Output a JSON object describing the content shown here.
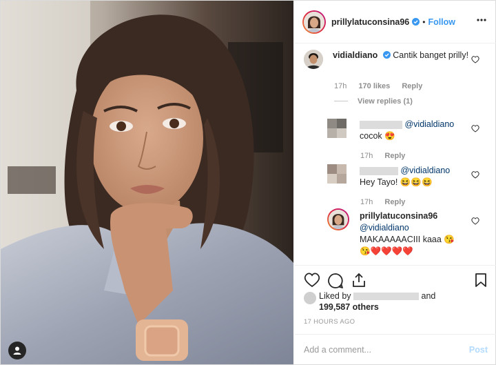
{
  "header": {
    "username": "prillylatuconsina96",
    "separator": "•",
    "follow_label": "Follow",
    "verified_icon": "verified-badge-icon",
    "more_icon": "more-options-icon"
  },
  "comments": {
    "main": {
      "username": "vidialdiano",
      "text": "Cantik banget prilly!",
      "time": "17h",
      "likes": "170 likes",
      "reply_label": "Reply",
      "view_replies": "View replies (1)"
    },
    "replies": [
      {
        "mention": "@vidialdiano",
        "text": "cocok 😍",
        "time": "17h",
        "reply_label": "Reply"
      },
      {
        "mention": "@vidialdiano",
        "text": "Hey Tayo! 😆😆😆",
        "time": "17h",
        "reply_label": "Reply"
      },
      {
        "username": "prillylatuconsina96",
        "mention": "@vidialdiano",
        "text": "MAKAAAAACIII kaaa 😘",
        "hearts": "😘❤️❤️❤️❤️"
      }
    ]
  },
  "likes": {
    "liked_by": "Liked by",
    "and": "and",
    "others": "199,587 others"
  },
  "timestamp": "17 HOURS AGO",
  "add_comment": {
    "placeholder": "Add a comment...",
    "post_label": "Post"
  },
  "colors": {
    "accent": "#3897f0",
    "post_disabled": "#b3dbff",
    "verified": "#3897f0",
    "heart_red": "#ed4956"
  }
}
